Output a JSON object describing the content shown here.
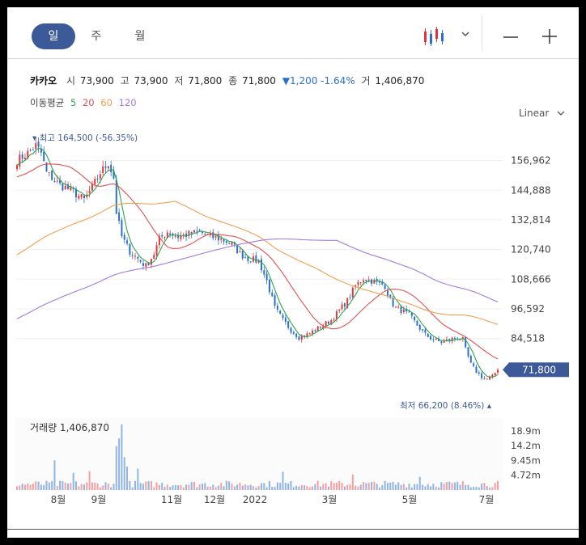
{
  "tabs": [
    "일",
    "주",
    "월"
  ],
  "info": {
    "name": "카카오",
    "open_label": "시",
    "open": "73,900",
    "high_label": "고",
    "high": "73,900",
    "low_label": "저",
    "low": "71,800",
    "close_label": "종",
    "close": "71,800",
    "change": "▼1,200 -1.64%",
    "volume_label": "거",
    "volume": "1,406,870"
  },
  "ma_legend": {
    "label": "이동평균",
    "items": [
      {
        "period": "5",
        "color": "#2ea44f"
      },
      {
        "period": "20",
        "color": "#e05252"
      },
      {
        "period": "60",
        "color": "#f0a050"
      },
      {
        "period": "120",
        "color": "#a37ae0"
      }
    ]
  },
  "scale_label": "Linear",
  "colors": {
    "up": "#e0363b",
    "down": "#2a6fc9",
    "accent": "#3d5a98",
    "ma5": "#2ea44f",
    "ma20": "#e05252",
    "ma60": "#f0a050",
    "ma120": "#a37ae0"
  },
  "icons": {
    "chart_type": "candlestick-icon",
    "dropdown": "chevron-down-icon",
    "zoom_out": "minus-icon",
    "zoom_in": "plus-icon"
  },
  "chart_data": {
    "type": "candlestick",
    "x_ticks": [
      "8월",
      "9월",
      "11월",
      "12월",
      "2022",
      "3월",
      "5월",
      "7월"
    ],
    "y_ticks": [
      156962,
      144888,
      132814,
      120740,
      108666,
      96592,
      84518
    ],
    "y_tick_labels": [
      "156,962",
      "144,888",
      "132,814",
      "120,740",
      "108,666",
      "96,592",
      "84,518"
    ],
    "ylim": [
      62000,
      170000
    ],
    "high_marker": {
      "label": "최고",
      "value": 164500,
      "text": "164,500 (-56.35%)"
    },
    "low_marker": {
      "label": "최저",
      "value": 66200,
      "text": "66,200 (8.46%)"
    },
    "last_price": {
      "value": 71800,
      "text": "71,800"
    },
    "price_keypoints": [
      [
        0,
        157000
      ],
      [
        4,
        160000
      ],
      [
        7,
        163000
      ],
      [
        9,
        160000
      ],
      [
        11,
        152000
      ],
      [
        13,
        150000
      ],
      [
        16,
        147000
      ],
      [
        20,
        145000
      ],
      [
        25,
        141000
      ],
      [
        28,
        146000
      ],
      [
        31,
        152000
      ],
      [
        34,
        156000
      ],
      [
        36,
        150000
      ],
      [
        37,
        136000
      ],
      [
        39,
        126000
      ],
      [
        42,
        120000
      ],
      [
        45,
        117000
      ],
      [
        48,
        114000
      ],
      [
        51,
        119000
      ],
      [
        53,
        125000
      ],
      [
        56,
        128000
      ],
      [
        60,
        126000
      ],
      [
        64,
        127000
      ],
      [
        68,
        128000
      ],
      [
        72,
        126000
      ],
      [
        76,
        125000
      ],
      [
        80,
        123000
      ],
      [
        83,
        119000
      ],
      [
        86,
        117000
      ],
      [
        90,
        116000
      ],
      [
        93,
        108000
      ],
      [
        96,
        97000
      ],
      [
        99,
        92000
      ],
      [
        102,
        88000
      ],
      [
        105,
        85000
      ],
      [
        108,
        86000
      ],
      [
        111,
        88000
      ],
      [
        114,
        90000
      ],
      [
        117,
        92000
      ],
      [
        120,
        96000
      ],
      [
        123,
        100000
      ],
      [
        126,
        106000
      ],
      [
        129,
        109000
      ],
      [
        132,
        108000
      ],
      [
        135,
        107000
      ],
      [
        137,
        106000
      ],
      [
        139,
        100000
      ],
      [
        141,
        97000
      ],
      [
        143,
        96000
      ],
      [
        146,
        94000
      ],
      [
        149,
        90000
      ],
      [
        152,
        86000
      ],
      [
        155,
        84000
      ],
      [
        158,
        83000
      ],
      [
        161,
        84000
      ],
      [
        164,
        85000
      ],
      [
        166,
        84000
      ],
      [
        167,
        80000
      ],
      [
        169,
        74000
      ],
      [
        171,
        71000
      ],
      [
        173,
        69000
      ],
      [
        175,
        68000
      ],
      [
        177,
        69000
      ],
      [
        178,
        70500
      ],
      [
        179,
        71800
      ]
    ],
    "volume": {
      "label": "거래량",
      "value": "1,406,870",
      "y_tick_labels": [
        "18.9m",
        "14.2m",
        "9.45m",
        "4.72m"
      ],
      "y_ticks": [
        18.9,
        14.2,
        9.45,
        4.72
      ],
      "ylim": [
        0,
        23
      ],
      "spikes": [
        {
          "i": 14,
          "v": 9.5
        },
        {
          "i": 37,
          "v": 14.0
        },
        {
          "i": 38,
          "v": 16.5
        },
        {
          "i": 39,
          "v": 21.0
        },
        {
          "i": 40,
          "v": 10.5
        },
        {
          "i": 41,
          "v": 7.5
        },
        {
          "i": 27,
          "v": 6.0
        },
        {
          "i": 21,
          "v": 5.5
        },
        {
          "i": 45,
          "v": 6.8
        },
        {
          "i": 99,
          "v": 5.8
        },
        {
          "i": 125,
          "v": 5.0
        },
        {
          "i": 150,
          "v": 4.2
        }
      ]
    }
  }
}
